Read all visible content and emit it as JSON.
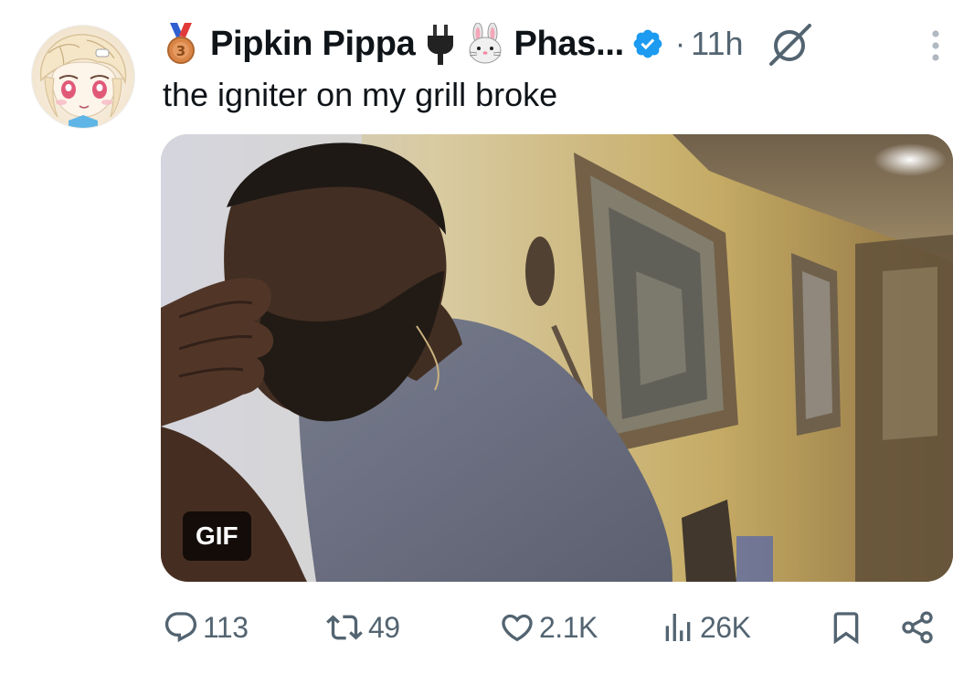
{
  "author": {
    "display_name": "Pipkin Pippa",
    "handle_truncated": "Phas...",
    "verified": true,
    "badge_emojis": [
      "3rd-place-medal-icon",
      "electric-plug-icon",
      "rabbit-face-icon"
    ]
  },
  "post": {
    "time_separator": "·",
    "time": "11h",
    "text": "the igniter on my grill broke"
  },
  "media": {
    "type_badge": "GIF"
  },
  "actions": {
    "replies": "113",
    "reposts": "49",
    "likes": "2.1K",
    "views": "26K"
  },
  "colors": {
    "text": "#0f1419",
    "secondary": "#536471",
    "verified_blue": "#1d9bf0"
  },
  "icons": {
    "grok": "grok-icon",
    "more": "more-vertical-icon",
    "reply": "reply-bubble-icon",
    "retweet": "retweet-icon",
    "like": "heart-icon",
    "views": "views-chart-icon",
    "bookmark": "bookmark-icon",
    "share": "share-icon"
  }
}
